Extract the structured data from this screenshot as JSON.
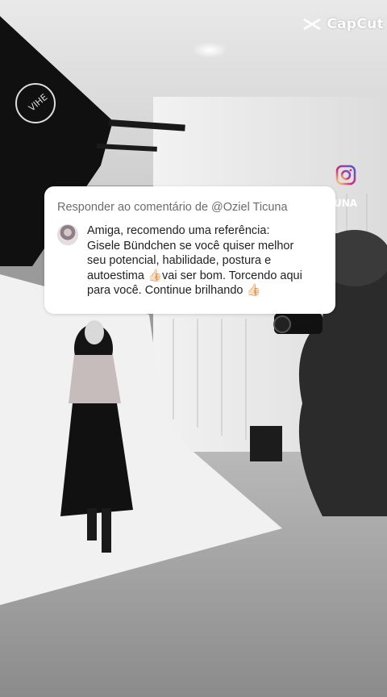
{
  "watermark": {
    "brand": "CapCut",
    "icon": "capcut-logo-icon"
  },
  "overlay": {
    "instagram_icon": "instagram-icon",
    "handle_fragment": "UNA"
  },
  "reply_card": {
    "header": "Responder ao comentário de @Oziel Ticuna",
    "avatar_icon": "user-avatar",
    "comment_lines": [
      "Amiga, recomendo uma referência:",
      "Gisele Bündchen se você quiser melhor",
      "seu potencial, habilidade, postura e",
      "autoestima 👍🏻vai ser bom.  Torcendo aqui",
      "para você. Continue brilhando 👍🏻"
    ]
  },
  "colors": {
    "card_bg": "#ffffff",
    "header_text": "#6c6c6c",
    "body_text": "#1f1f1f"
  }
}
